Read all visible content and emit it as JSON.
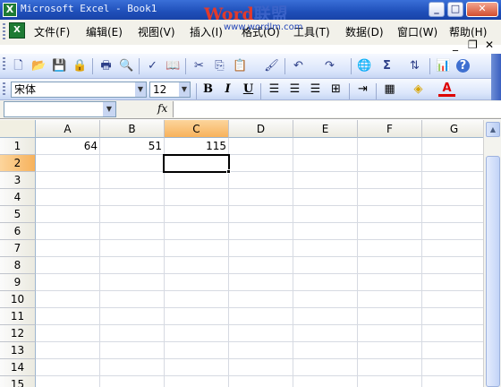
{
  "window": {
    "title": "Microsoft Excel - Book1",
    "watermark_word": "Word",
    "watermark_cn": "联盟",
    "watermark_url": "www.wordlm.com",
    "min_glyph": "_",
    "max_glyph": "□",
    "close_glyph": "✕"
  },
  "menu": {
    "items": [
      "文件(F)",
      "编辑(E)",
      "视图(V)",
      "插入(I)",
      "格式(O)",
      "工具(T)",
      "数据(D)",
      "窗口(W)",
      "帮助(H)"
    ],
    "doc_min": "_",
    "doc_restore": "❐",
    "doc_close": "✕"
  },
  "toolbar": {
    "icons": [
      "new-icon",
      "open-icon",
      "save-icon",
      "permission-icon",
      "print-icon",
      "print-preview-icon",
      "spelling-icon",
      "research-icon",
      "cut-icon",
      "copy-icon",
      "paste-icon",
      "format-painter-icon",
      "undo-icon",
      "redo-icon",
      "hyperlink-icon",
      "autosum-icon",
      "sort-ascending-icon",
      "chart-wizard-icon",
      "help-icon"
    ],
    "glyphs": [
      "🗋",
      "📂",
      "💾",
      "🔒",
      "🖶",
      "🔍",
      "✓",
      "📖",
      "✂",
      "⎘",
      "📋",
      "🖌",
      "↶",
      "↷",
      "🌐",
      "Σ",
      "⇅",
      "📊",
      "?"
    ]
  },
  "format": {
    "font_name": "宋体",
    "font_size": "12",
    "bold": "B",
    "italic": "I",
    "underline": "U"
  },
  "formula": {
    "name_box": "",
    "fx_label": "fx",
    "content": ""
  },
  "sheet": {
    "columns": [
      "A",
      "B",
      "C",
      "D",
      "E",
      "F",
      "G"
    ],
    "rows": [
      "1",
      "2",
      "3",
      "4",
      "5",
      "6",
      "7",
      "8",
      "9",
      "10",
      "11",
      "12",
      "13",
      "14",
      "15"
    ],
    "selected_column": "C",
    "selected_row": "2",
    "cells": {
      "A1": "64",
      "B1": "51",
      "C1": "115"
    }
  },
  "colors": {
    "accent": "#1f4fb9",
    "selection_header": "#f7b25c",
    "watermark_red": "#e23a2c",
    "watermark_blue": "#3a62c8"
  }
}
